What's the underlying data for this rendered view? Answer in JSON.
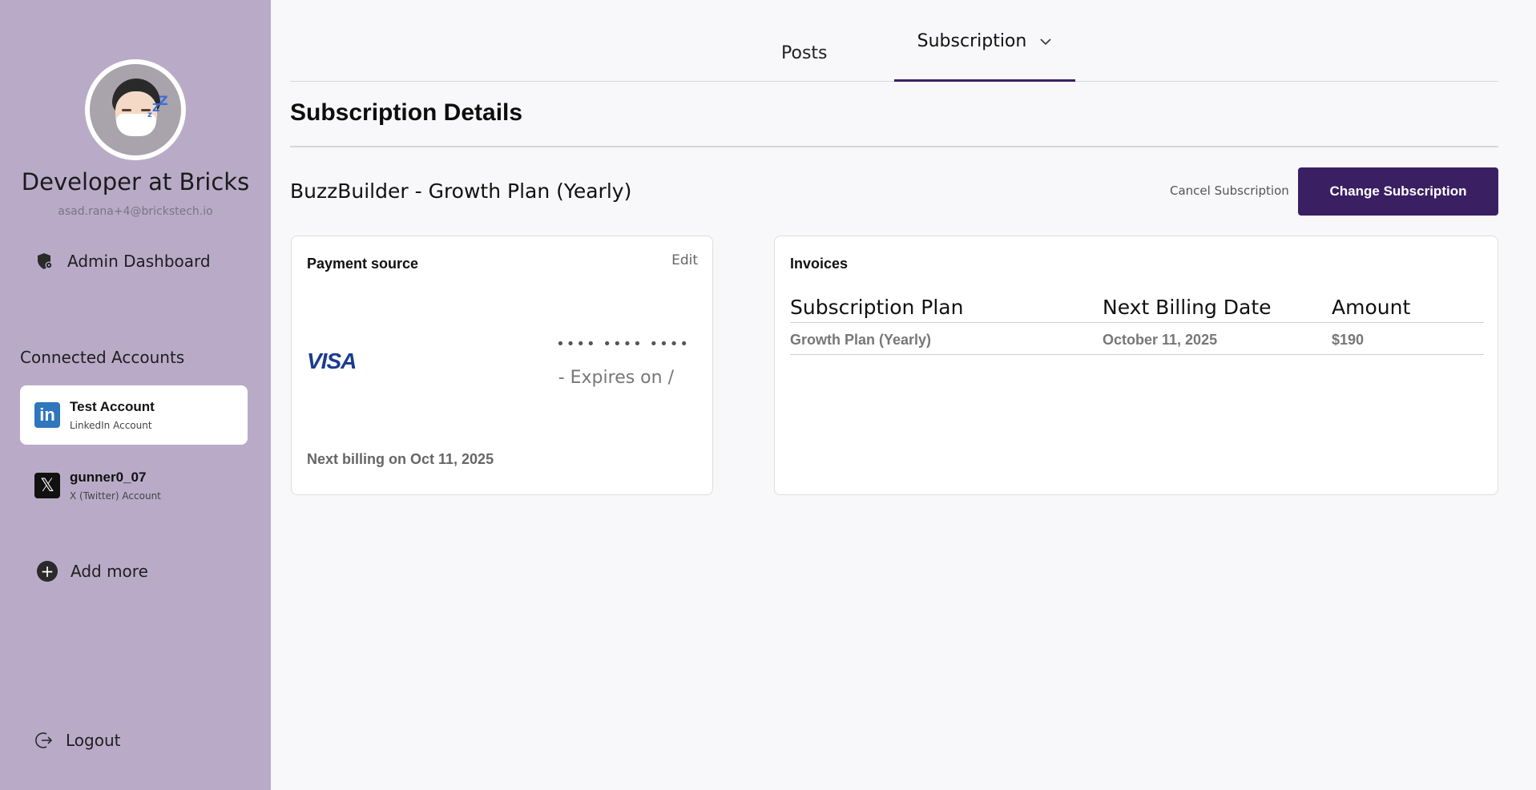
{
  "sidebar": {
    "user_name": "Developer at Bricks",
    "user_email": "asad.rana+4@brickstech.io",
    "admin_label": "Admin Dashboard",
    "connected_title": "Connected Accounts",
    "accounts": [
      {
        "name": "Test Account",
        "type": "LinkedIn Account",
        "icon": "linkedin-icon",
        "logo_text": "in"
      },
      {
        "name": "gunner0_07",
        "type": "X (Twitter) Account",
        "icon": "x-twitter-icon",
        "logo_text": "𝕏"
      }
    ],
    "add_more_label": "Add more",
    "logout_label": "Logout"
  },
  "tabs": {
    "posts": "Posts",
    "subscription": "Subscription"
  },
  "main": {
    "title": "Subscription Details",
    "plan_name": "BuzzBuilder - Growth Plan (Yearly)",
    "cancel_label": "Cancel Subscription",
    "change_label": "Change Subscription"
  },
  "payment": {
    "title": "Payment source",
    "edit_label": "Edit",
    "brand": "VISA",
    "masked_number": "•••• •••• ••••",
    "expires": "- Expires on /",
    "next_billing": "Next billing on Oct 11, 2025"
  },
  "invoices": {
    "title": "Invoices",
    "columns": [
      "Subscription Plan",
      "Next Billing Date",
      "Amount"
    ],
    "rows": [
      [
        "Growth Plan (Yearly)",
        "October 11, 2025",
        "$190"
      ]
    ]
  },
  "colors": {
    "sidebar_bg": "#b9abc8",
    "accent": "#3a1f63",
    "page_bg": "#f8f8fa"
  }
}
